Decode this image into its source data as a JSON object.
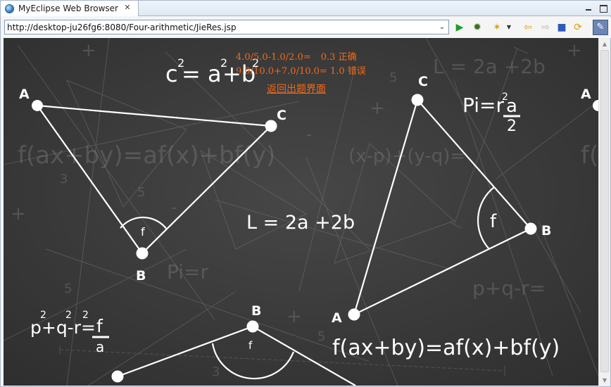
{
  "tab": {
    "title": "MyEclipse Web Browser",
    "close_symbol": "✕",
    "icon": "globe-icon"
  },
  "toolbar": {
    "url_value": "http://desktop-ju26fg6:8080/Four-arithmetic/JieRes.jsp",
    "dropdown_symbol": "⌄",
    "icons": {
      "run": "▶",
      "debug": "✹",
      "favorite": "✶",
      "favorite_drop": "▼",
      "back": "⇦",
      "forward": "⇨",
      "stop": "■",
      "refresh": "⟳",
      "tool": "✎"
    }
  },
  "results": {
    "lines": [
      {
        "expression": "4.0/5.0-1.0/2.0=",
        "answer": "0.3",
        "verdict": "正确"
      },
      {
        "expression": "9.0/10.0+7.0/10.0=",
        "answer": "1.0",
        "verdict": "错误"
      }
    ],
    "back_link": "返回出题界面",
    "color": "#f06a1a"
  },
  "chalkboard": {
    "formula_top": {
      "base": "c",
      "eq": "= a",
      "plus": "+b",
      "exp": "2"
    },
    "formula_pi": {
      "left": "Pi=r",
      "exp": "2",
      "num": "a",
      "den": "2"
    },
    "formula_L": "L = 2a +2b",
    "formula_pqr": {
      "text": "p+q-r=",
      "exp": "2",
      "num": "f",
      "den": "a"
    },
    "formula_f": "f(ax+by)=af(x)+bf(y)",
    "labels": {
      "A": "A",
      "B": "B",
      "C": "C",
      "f": "f"
    },
    "bg_formulas": {
      "f_bg": "f(ax+by)=af(x)+bf(y)",
      "xp": "(x-p)+(y-q)=",
      "L_bg": "L = 2a +2b",
      "pi_bg": "Pi=r",
      "pqr_bg": "p+q-r=",
      "digit_5": "5",
      "digit_3": "3",
      "plus": "+",
      "minus": "-"
    }
  }
}
